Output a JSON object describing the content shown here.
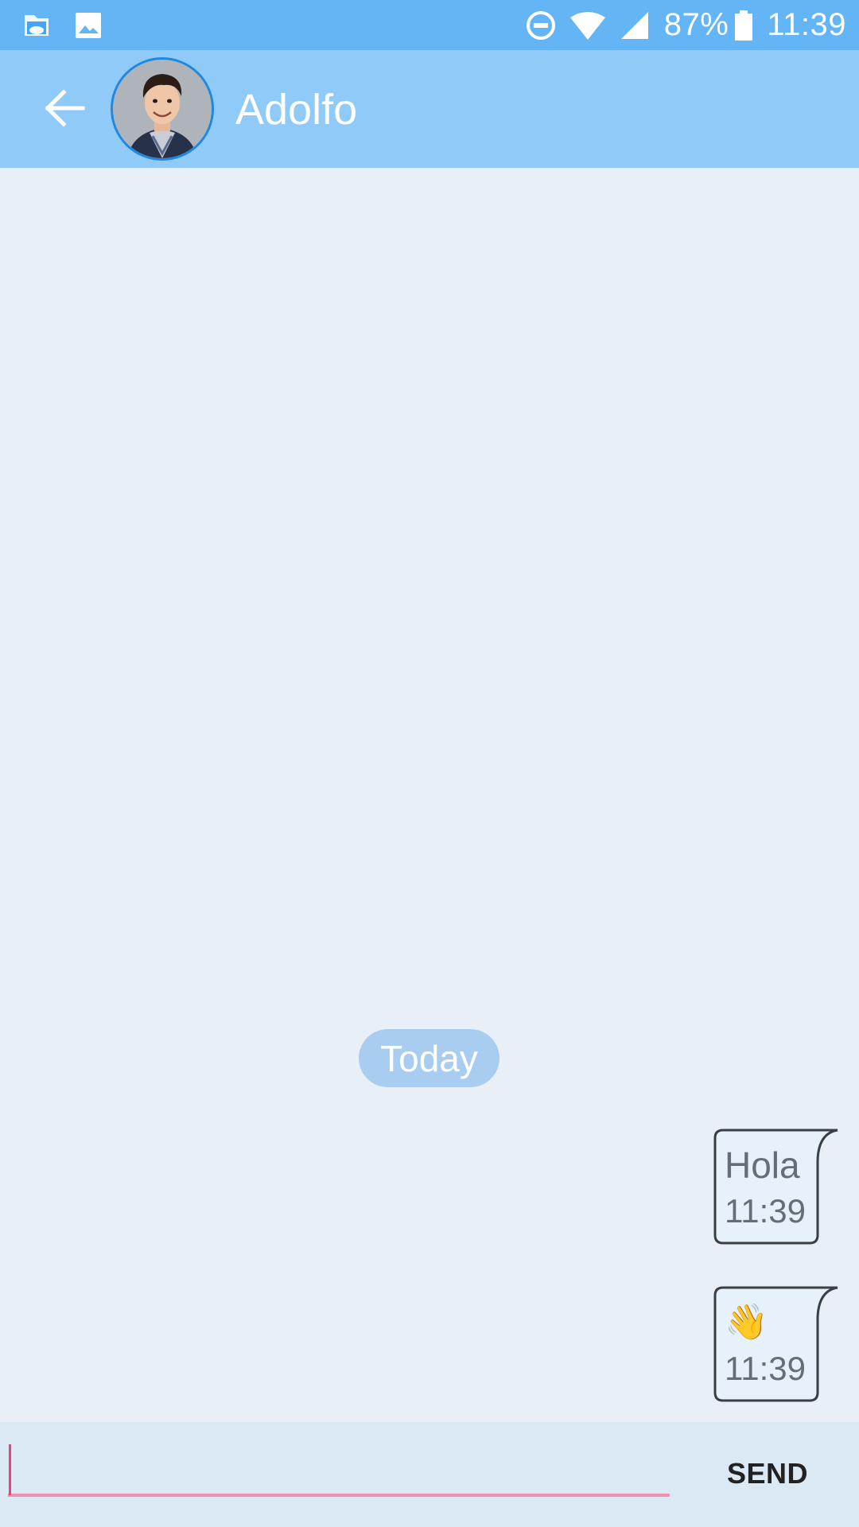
{
  "status_bar": {
    "left_icons": [
      "file-manager-icon",
      "image-icon"
    ],
    "right_icons": [
      "do-not-disturb-icon",
      "wifi-icon",
      "cell-signal-icon",
      "battery-icon"
    ],
    "battery": "87%",
    "time": "11:39",
    "color": "#64b5f6"
  },
  "header": {
    "back_icon": "arrow-left-icon",
    "contact_name": "Adolfo",
    "color": "#90caf9"
  },
  "chat": {
    "date_separator": "Today",
    "messages": [
      {
        "text": "Hola",
        "time": "11:39",
        "sender": "me"
      },
      {
        "text": "👋",
        "time": "11:39",
        "sender": "me"
      }
    ]
  },
  "composer": {
    "input_value": "",
    "input_placeholder": "",
    "send_label": "SEND",
    "accent": "#f48fb1"
  }
}
